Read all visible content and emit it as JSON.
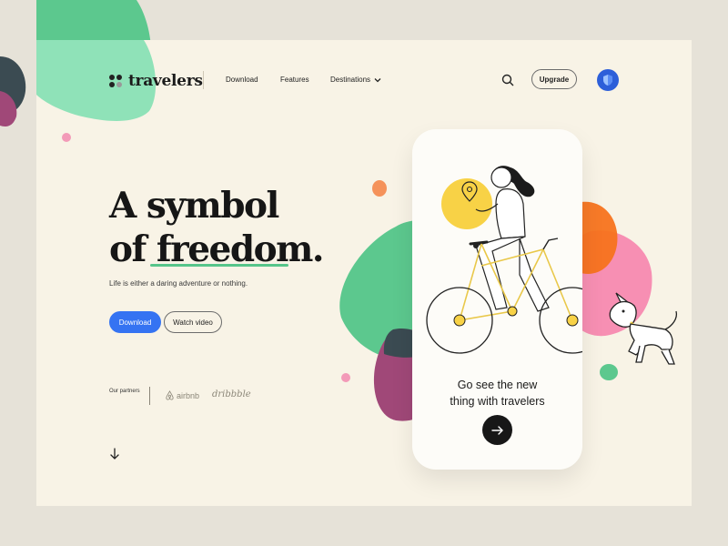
{
  "brand": {
    "name": "travelers"
  },
  "nav": {
    "download": "Download",
    "features": "Features",
    "destinations": "Destinations",
    "upgrade": "Upgrade"
  },
  "hero": {
    "title_line1": "A symbol",
    "title_line2a": "of ",
    "title_line2b": "freedom",
    "title_line2c": ".",
    "tagline": "Life is either a daring adventure or nothing.",
    "download_button": "Download",
    "watch_button": "Watch video"
  },
  "partners": {
    "label": "Our partners",
    "airbnb": "airbnb",
    "dribbble": "dribbble"
  },
  "phone": {
    "line1": "Go see the new",
    "line2": "thing with travelers"
  },
  "icons": {
    "logo": "four-dots-logo-icon",
    "search": "search-icon",
    "chevron": "chevron-down-icon",
    "avatar": "shield-avatar-icon",
    "scroll": "arrow-down-icon",
    "next": "arrow-right-icon"
  },
  "colors": {
    "accent_blue": "#3573f2",
    "green": "#56c58a",
    "pink": "#f78fb3",
    "orange": "#f7731e",
    "purple": "#9b3d77",
    "yellow": "#f8d246",
    "background": "#f8f3e6"
  }
}
